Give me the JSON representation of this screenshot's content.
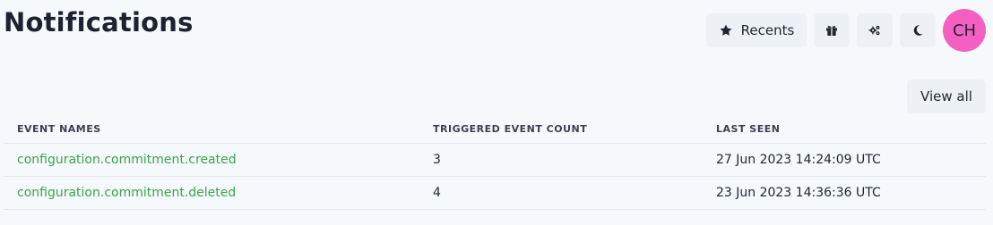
{
  "page": {
    "title": "Notifications"
  },
  "header": {
    "recents_label": "Recents",
    "avatar_initials": "CH",
    "icons": {
      "recents": "star-icon",
      "gift": "gift-icon",
      "settings": "gears-icon",
      "theme": "moon-icon"
    },
    "colors": {
      "avatar_bg": "#f55fc1",
      "button_bg": "#edf1f5",
      "link": "#3ba446"
    }
  },
  "actions": {
    "view_all_label": "View all"
  },
  "table": {
    "columns": [
      "EVENT NAMES",
      "TRIGGERED EVENT COUNT",
      "LAST SEEN"
    ],
    "rows": [
      {
        "event_name": "configuration.commitment.created",
        "count": "3",
        "last_seen": "27 Jun 2023 14:24:09 UTC"
      },
      {
        "event_name": "configuration.commitment.deleted",
        "count": "4",
        "last_seen": "23 Jun 2023 14:36:36 UTC"
      }
    ]
  }
}
